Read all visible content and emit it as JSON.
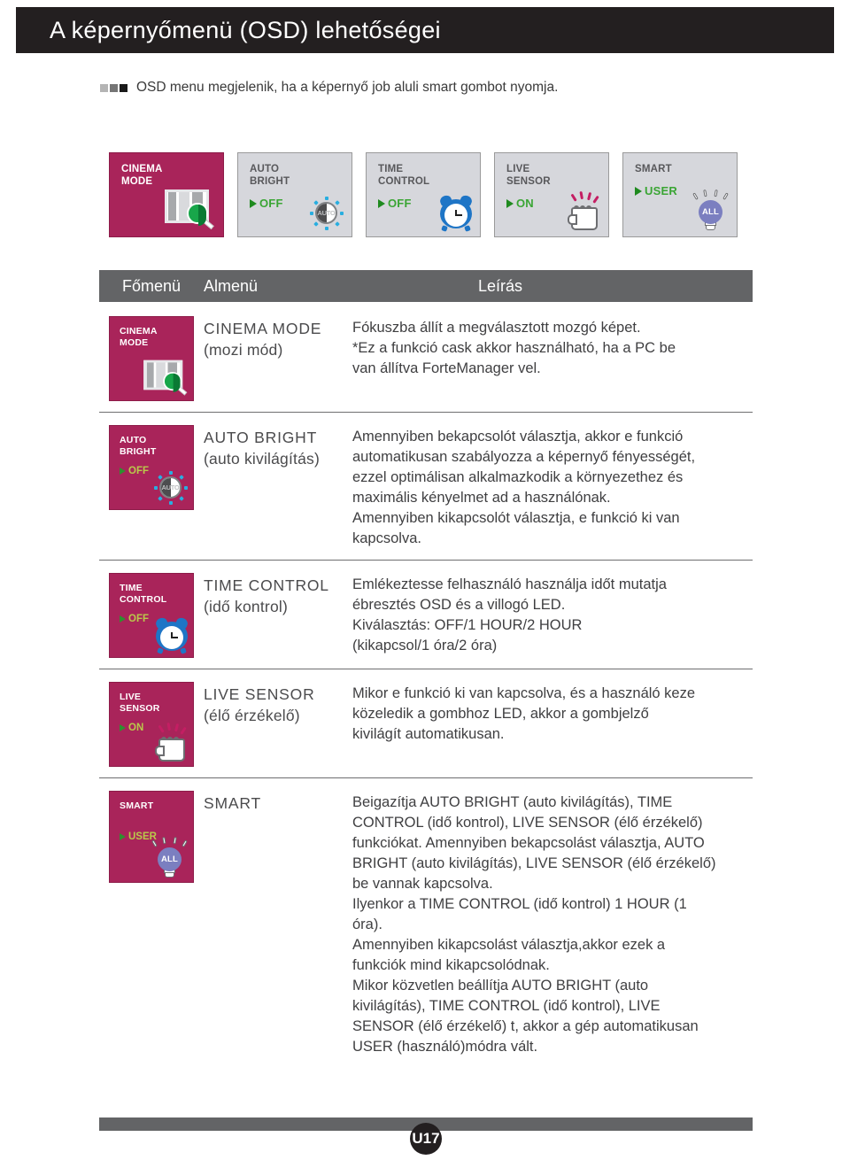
{
  "header": {
    "title": "A képernyőmenü (OSD) lehetőségei"
  },
  "intro": {
    "text": "OSD menu megjelenik, ha a képernyő job aluli smart gombot nyomja."
  },
  "osd_panels": [
    {
      "title_line1": "CINEMA",
      "title_line2": "MODE",
      "value": "",
      "icon": "cinema-magnifier-icon",
      "highlighted": true
    },
    {
      "title_line1": "AUTO",
      "title_line2": "BRIGHT",
      "value": "OFF",
      "icon": "auto-sun-icon",
      "highlighted": false
    },
    {
      "title_line1": "TIME",
      "title_line2": "CONTROL",
      "value": "OFF",
      "icon": "alarm-clock-icon",
      "highlighted": false
    },
    {
      "title_line1": "LIVE",
      "title_line2": "SENSOR",
      "value": "ON",
      "icon": "hand-touch-icon",
      "highlighted": false
    },
    {
      "title_line1": "SMART",
      "title_line2": "",
      "value": "USER",
      "icon": "light-bulb-all-icon",
      "highlighted": false
    }
  ],
  "table": {
    "headers": {
      "main": "Főmenü",
      "sub": "Almenü",
      "desc": "Leírás"
    },
    "rows": [
      {
        "tile": {
          "title_line1": "CINEMA",
          "title_line2": "MODE",
          "value": "",
          "icon": "cinema-magnifier-icon"
        },
        "sub_name": "CINEMA MODE",
        "sub_trans": "(mozi mód)",
        "desc": [
          "Fókuszba állít a megválasztott mozgó képet.",
          "*Ez a funkció cask akkor használható, ha a PC be",
          "van állítva ForteManager vel."
        ]
      },
      {
        "tile": {
          "title_line1": "AUTO",
          "title_line2": "BRIGHT",
          "value": "OFF",
          "icon": "auto-sun-icon"
        },
        "sub_name": "AUTO BRIGHT",
        "sub_trans": "(auto kivilágítás)",
        "desc": [
          "Amennyiben bekapcsolót választja, akkor e funkció",
          "automatikusan szabályozza a képernyő fényességét,",
          "ezzel optimálisan alkalmazkodik a környezethez és",
          "maximális kényelmet ad a használónak.",
          "Amennyiben kikapcsolót választja, e funkció ki van",
          "kapcsolva."
        ]
      },
      {
        "tile": {
          "title_line1": "TIME",
          "title_line2": "CONTROL",
          "value": "OFF",
          "icon": "alarm-clock-icon"
        },
        "sub_name": "TIME CONTROL",
        "sub_trans": "(idő kontrol)",
        "desc": [
          "Emlékeztesse felhasználó használja időt mutatja",
          "ébresztés OSD és a villogó LED.",
          "Kiválasztás: OFF/1 HOUR/2 HOUR",
          "(kikapcsol/1 óra/2 óra)"
        ]
      },
      {
        "tile": {
          "title_line1": "LIVE",
          "title_line2": "SENSOR",
          "value": "ON",
          "icon": "hand-touch-icon"
        },
        "sub_name": "LIVE SENSOR",
        "sub_trans": "(élő érzékelő)",
        "desc": [
          "Mikor e funkció ki van kapcsolva, és a használó keze",
          "közeledik a gombhoz LED, akkor a gombjelző",
          "kivilágít automatikusan."
        ]
      },
      {
        "tile": {
          "title_line1": "SMART",
          "title_line2": "",
          "value": "USER",
          "icon": "light-bulb-all-icon"
        },
        "sub_name": "SMART",
        "sub_trans": "",
        "desc": [
          "Beigazítja AUTO BRIGHT (auto kivilágítás), TIME",
          "CONTROL (idő kontrol), LIVE SENSOR (élő érzékelő)",
          "funkciókat. Amennyiben bekapcsolást választja, AUTO",
          "BRIGHT (auto kivilágítás), LIVE SENSOR (élő érzékelő)",
          "be vannak kapcsolva.",
          "Ilyenkor a TIME CONTROL (idő kontrol) 1 HOUR (1",
          "óra).",
          "Amennyiben kikapcsolást választja,akkor ezek a",
          "funkciók mind kikapcsolódnak.",
          "Mikor közvetlen beállítja AUTO BRIGHT (auto",
          "kivilágítás), TIME CONTROL (idő kontrol), LIVE",
          "SENSOR (élő érzékelő) t, akkor a gép automatikusan",
          "USER (használó)módra vált."
        ]
      }
    ]
  },
  "footer": {
    "page_label": "U17"
  },
  "colors": {
    "title_bar": "#231f20",
    "magenta_tile": "#a9245a",
    "header_gray": "#636466",
    "panel_gray": "#d6d7dc",
    "value_green": "#3aa534",
    "tile_value": "#b9c94a"
  }
}
